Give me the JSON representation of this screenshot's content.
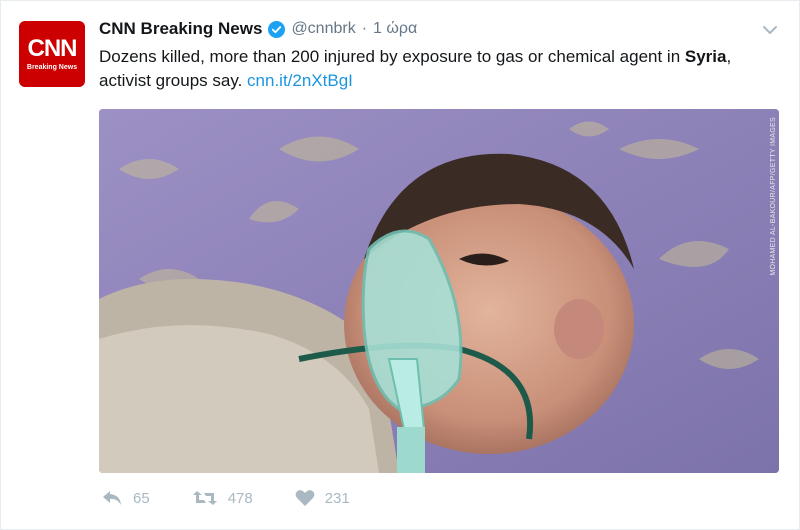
{
  "tweet": {
    "account": {
      "name": "CNN Breaking News",
      "handle": "@cnnbrk",
      "avatar_logo": "CNN",
      "avatar_sub": "Breaking News"
    },
    "separator": "·",
    "time": "1 ώρα",
    "text": {
      "part1": "Dozens killed, more than 200 injured by exposure to gas or chemical agent in ",
      "bold": "Syria",
      "part2": ", activist groups say. ",
      "link": "cnn.it/2nXtBgI"
    },
    "media": {
      "credit": "MOHAMED AL-BAKOUR/AFP/GETTY IMAGES"
    },
    "actions": {
      "reply_count": "65",
      "retweet_count": "478",
      "like_count": "231"
    },
    "icons": [
      "verified-icon",
      "chevron-down-icon",
      "reply-icon",
      "retweet-icon",
      "heart-icon"
    ],
    "colors": {
      "brand": "#cc0000",
      "link": "#1b95e0",
      "verified": "#1da1f2",
      "muted": "#aab8c2"
    }
  }
}
